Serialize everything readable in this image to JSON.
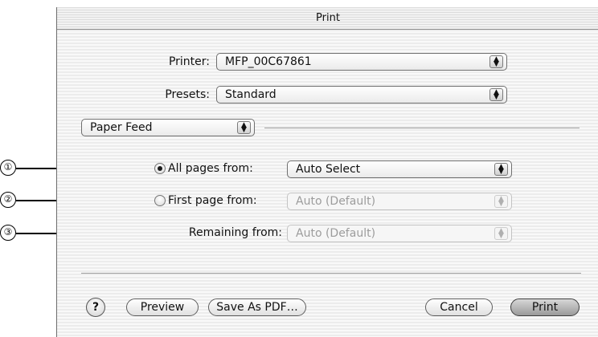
{
  "dialog": {
    "title": "Print"
  },
  "printer": {
    "label": "Printer:",
    "value": "MFP_00C67861"
  },
  "presets": {
    "label": "Presets:",
    "value": "Standard"
  },
  "panel_select": {
    "value": "Paper Feed"
  },
  "paper_feed": {
    "all_pages": {
      "label": "All pages from:",
      "value": "Auto Select",
      "selected": true
    },
    "first_page": {
      "label": "First page from:",
      "value": "Auto (Default)",
      "selected": false
    },
    "remaining": {
      "label": "Remaining from:",
      "value": "Auto (Default)"
    }
  },
  "callouts": [
    "①",
    "②",
    "③"
  ],
  "buttons": {
    "help": "?",
    "preview": "Preview",
    "save_pdf": "Save As PDF…",
    "cancel": "Cancel",
    "print": "Print"
  }
}
